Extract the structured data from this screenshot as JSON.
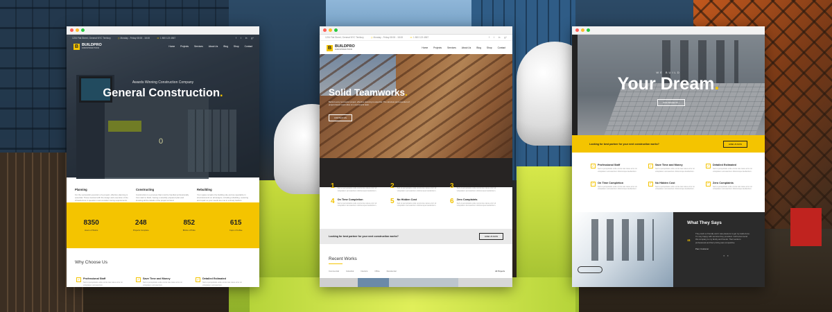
{
  "brand": {
    "name": "BUILDPRO",
    "tagline": "CONSTRUCTION",
    "accent": "#f4c400"
  },
  "topbar": {
    "address": "1234 Flat Street, General NYC Territory",
    "hours": "Monday - Friday 08:00 - 18:00",
    "phone": "1 800 123 4567",
    "social": [
      "f",
      "t",
      "in",
      "g+"
    ]
  },
  "nav": {
    "items": [
      "Home",
      "Projects",
      "Services",
      "About Us",
      "Blog",
      "Shop",
      "Contact"
    ]
  },
  "window1": {
    "hero": {
      "kicker": "Awards Winning Construction Company",
      "title": "General Construction",
      "counter": "0"
    },
    "services": [
      {
        "title": "Planning",
        "text": "For the successful execution of a project, effective planning is essential. Those involved with the design and execution of the infrastructure in question must consider zoning requirements.",
        "more": "read more"
      },
      {
        "title": "Constructing",
        "text": "Construction is a process that must be handled professionally from start to finish, having a carefully prepared plan and knowing all the details of the project at hand.",
        "more": "read more"
      },
      {
        "title": "Rebuilding",
        "text": "Your space remains the building site and we specialize in structural work on all designs, including rebuilding, restoring and repair so your needs are met in a timely fashion.",
        "more": "read more"
      }
    ],
    "stats": [
      {
        "value": "8350",
        "label": "Hours of Works"
      },
      {
        "value": "248",
        "label": "Projects Complete"
      },
      {
        "value": "852",
        "label": "Bricks of Pride"
      },
      {
        "value": "615",
        "label": "Cups of Coffee"
      }
    ],
    "why_title": "Why Choose Us",
    "features": [
      {
        "title": "Professional Staff",
        "text": "Sed ut perspiciatis unde omnis iste natus error sit voluptatem accusantium."
      },
      {
        "title": "Save Time and Money",
        "text": "Sed ut perspiciatis unde omnis iste natus error sit voluptatem accusantium."
      },
      {
        "title": "Detailed Estimated",
        "text": "Sed ut perspiciatis unde omnis iste natus error sit voluptatem accusantium."
      }
    ]
  },
  "window2": {
    "hero": {
      "title": "Solid Teamworks",
      "text": "Behind every successful project, effective planning is essential. The structure and execution of project-based work relies on a successful team.",
      "cta": "CONTACT US"
    },
    "features": [
      {
        "num": "1",
        "title": "Professional Staff",
        "text": "Sed ut perspiciatis unde omnis iste natus error sit voluptatem accusantium doloremque laudantium."
      },
      {
        "num": "2",
        "title": "Save Time and Money",
        "text": "Sed ut perspiciatis unde omnis iste natus error sit voluptatem accusantium doloremque laudantium."
      },
      {
        "num": "3",
        "title": "Detailed Estimated",
        "text": "Sed ut perspiciatis unde omnis iste natus error sit voluptatem accusantium doloremque laudantium."
      },
      {
        "num": "4",
        "title": "On Time Completion",
        "text": "Sed ut perspiciatis unde omnis iste natus error sit voluptatem accusantium doloremque laudantium."
      },
      {
        "num": "5",
        "title": "No Hidden Cost",
        "text": "Sed ut perspiciatis unde omnis iste natus error sit voluptatem accusantium doloremque laudantium."
      },
      {
        "num": "6",
        "title": "Zero Complaints",
        "text": "Sed ut perspiciatis unde omnis iste natus error sit voluptatem accusantium doloremque laudantium."
      }
    ],
    "band": {
      "text": "Looking for best partner for your next construction works?",
      "button": "HIRE US NOW"
    },
    "recent_title": "Recent Works",
    "filters": [
      "Commercial",
      "Industrial",
      "Interiors",
      "Office",
      "Residential"
    ],
    "all_projects": "All Projects"
  },
  "window3": {
    "hero": {
      "kicker": "WE BUILD",
      "title": "Your Dream",
      "cta": "OUR PROJECTS"
    },
    "band": {
      "text": "Looking for best partner for your next construction works?",
      "button": "HIRE US NOW"
    },
    "features": [
      {
        "title": "Professional Staff",
        "text": "Sed ut perspiciatis unde omnis iste natus error sit voluptatem accusantium doloremque laudantium."
      },
      {
        "title": "Save Time and Money",
        "text": "Sed ut perspiciatis unde omnis iste natus error sit voluptatem accusantium doloremque laudantium."
      },
      {
        "title": "Detailed Estimated",
        "text": "Sed ut perspiciatis unde omnis iste natus error sit voluptatem accusantium doloremque laudantium."
      },
      {
        "title": "On Time Completion",
        "text": "Sed ut perspiciatis unde omnis iste natus error sit voluptatem accusantium doloremque laudantium."
      },
      {
        "title": "No Hidden Cost",
        "text": "Sed ut perspiciatis unde omnis iste natus error sit voluptatem accusantium doloremque laudantium."
      },
      {
        "title": "Zero Complaints",
        "text": "Sed ut perspiciatis unde omnis iste natus error sit voluptatem accusantium doloremque laudantium."
      }
    ],
    "testimonial": {
      "title": "What They Says",
      "quote": "They work so friendly and it was pleasure to get my tasks done. I'm very happy with services they provided. I will recommend this company to my family and friends. Their works is professional and their pricing was competitive.",
      "author": "Paul, Customer"
    }
  }
}
